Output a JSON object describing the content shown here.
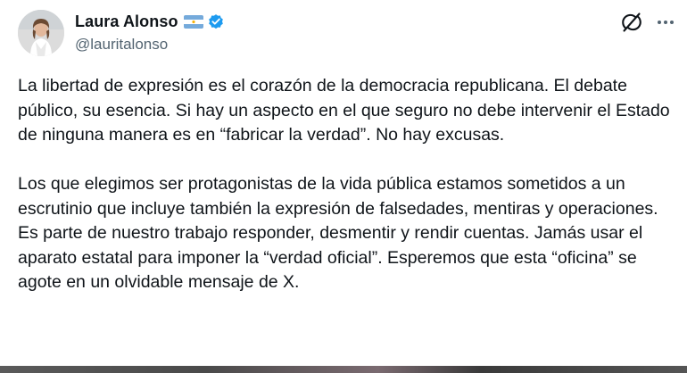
{
  "author": {
    "display_name": "Laura Alonso",
    "handle": "@lauritalonso",
    "flag_icon": "argentina-flag-icon",
    "verified_icon": "verified-badge-icon",
    "verified_color": "#1d9bf0"
  },
  "actions": {
    "grok_icon": "grok-icon",
    "more_icon": "more-options-icon"
  },
  "tweet": {
    "paragraphs": [
      "La libertad de expresión es el corazón de la democracia republicana. El debate público, su esencia. Si hay un aspecto en el que seguro no debe intervenir el Estado de ninguna manera es en “fabricar la verdad”. No hay excusas.",
      "Los que elegimos ser protagonistas de la vida pública estamos sometidos a un escrutinio que incluye también la expresión de falsedades, mentiras y operaciones. Es parte de nuestro trabajo responder, desmentir y rendir cuentas. Jamás usar el aparato estatal para imponer la “verdad oficial”. Esperemos que esta “oficina” se agote en un olvidable mensaje de X."
    ]
  },
  "colors": {
    "text": "#0f1419",
    "secondary_text": "#536471",
    "background": "#ffffff"
  }
}
